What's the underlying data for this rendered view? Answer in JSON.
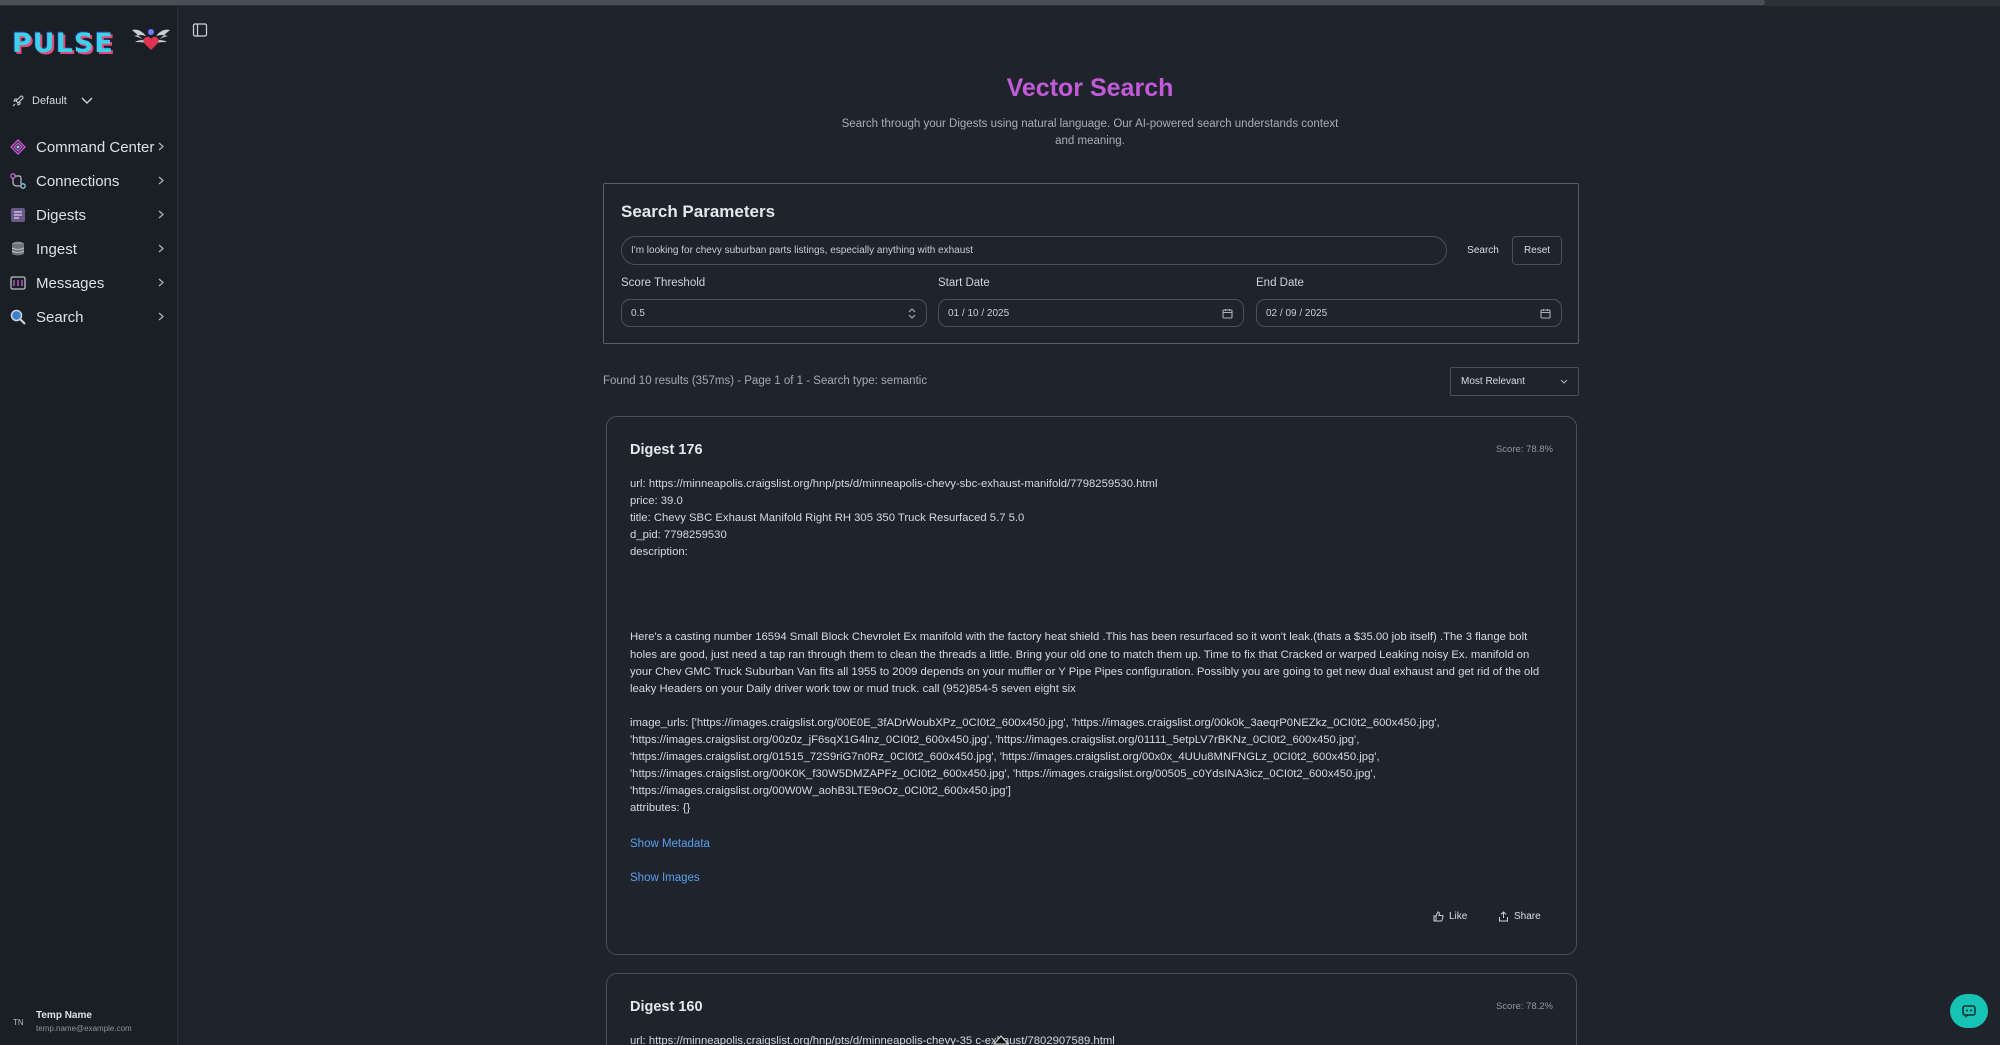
{
  "app": {
    "logo_text": "PULSE",
    "workspace": "Default"
  },
  "sidebar": {
    "items": [
      {
        "label": "Command Center",
        "icon": "command-center-icon"
      },
      {
        "label": "Connections",
        "icon": "connections-icon"
      },
      {
        "label": "Digests",
        "icon": "digests-icon"
      },
      {
        "label": "Ingest",
        "icon": "ingest-icon"
      },
      {
        "label": "Messages",
        "icon": "messages-icon"
      },
      {
        "label": "Search",
        "icon": "search-icon"
      }
    ],
    "user": {
      "initials": "TN",
      "name": "Temp Name",
      "email": "temp.name@example.com"
    }
  },
  "page": {
    "title": "Vector Search",
    "subtitle": "Search through your Digests using natural language. Our AI-powered search understands context and meaning."
  },
  "search": {
    "heading": "Search Parameters",
    "query": "I'm looking for chevy suburban parts listings, especially anything with exhaust",
    "search_label": "Search",
    "reset_label": "Reset",
    "score_threshold_label": "Score Threshold",
    "score_threshold_value": "0.5",
    "start_date_label": "Start Date",
    "start_date_value": "01 / 10 / 2025",
    "end_date_label": "End Date",
    "end_date_value": "02 / 09 / 2025"
  },
  "results": {
    "summary": "Found 10 results (357ms) - Page 1 of 1 - Search type: semantic",
    "sort_selected": "Most Relevant",
    "items": [
      {
        "title": "Digest 176",
        "score": "Score: 78.8%",
        "url": "url: https://minneapolis.craigslist.org/hnp/pts/d/minneapolis-chevy-sbc-exhaust-manifold/7798259530.html",
        "price": "price: 39.0",
        "listing_title": "title: Chevy SBC Exhaust Manifold Right RH 305 350 Truck Resurfaced 5.7 5.0",
        "d_pid": "d_pid: 7798259530",
        "description_label": "description:",
        "description": "Here's a casting number 16594 Small Block Chevrolet Ex manifold with the factory heat shield .This has been resurfaced so it won't leak.(thats a $35.00 job itself) .The 3 flange bolt holes are good, just need a tap ran through them to clean the threads a little. Bring your old one to match them up. Time to fix that Cracked or warped Leaking noisy Ex. manifold on your Chev GMC Truck Suburban Van fits all 1955 to 2009 depends on your muffler or Y Pipe Pipes configuration. Possibly you are going to get new dual exhaust and get rid of the old leaky Headers on your Daily driver work tow or mud truck. call (952)854-5 seven eight six",
        "image_urls": "image_urls: ['https://images.craigslist.org/00E0E_3fADrWoubXPz_0CI0t2_600x450.jpg', 'https://images.craigslist.org/00k0k_3aeqrP0NEZkz_0CI0t2_600x450.jpg', 'https://images.craigslist.org/00z0z_jF6sqX1G4lnz_0CI0t2_600x450.jpg', 'https://images.craigslist.org/01111_5etpLV7rBKNz_0CI0t2_600x450.jpg', 'https://images.craigslist.org/01515_72S9riG7n0Rz_0CI0t2_600x450.jpg', 'https://images.craigslist.org/00x0x_4UUu8MNFNGLz_0CI0t2_600x450.jpg', 'https://images.craigslist.org/00K0K_f30W5DMZAPFz_0CI0t2_600x450.jpg', 'https://images.craigslist.org/00505_c0YdsINA3icz_0CI0t2_600x450.jpg', 'https://images.craigslist.org/00W0W_aohB3LTE9oOz_0CI0t2_600x450.jpg']",
        "attributes": "attributes: {}",
        "show_metadata": "Show Metadata",
        "show_images": "Show Images",
        "like": "Like",
        "share": "Share"
      },
      {
        "title": "Digest 160",
        "score": "Score: 78.2%",
        "url": "url: https://minneapolis.craigslist.org/hnp/pts/d/minneapolis-chevy-35   c-exhaust/7802907589.html"
      }
    ]
  },
  "colors": {
    "accent_title": "#c35bd8",
    "link": "#5a9ff0",
    "chat_fab": "#16c3b4",
    "background": "#1f242c",
    "sidebar": "#1a1e25"
  }
}
